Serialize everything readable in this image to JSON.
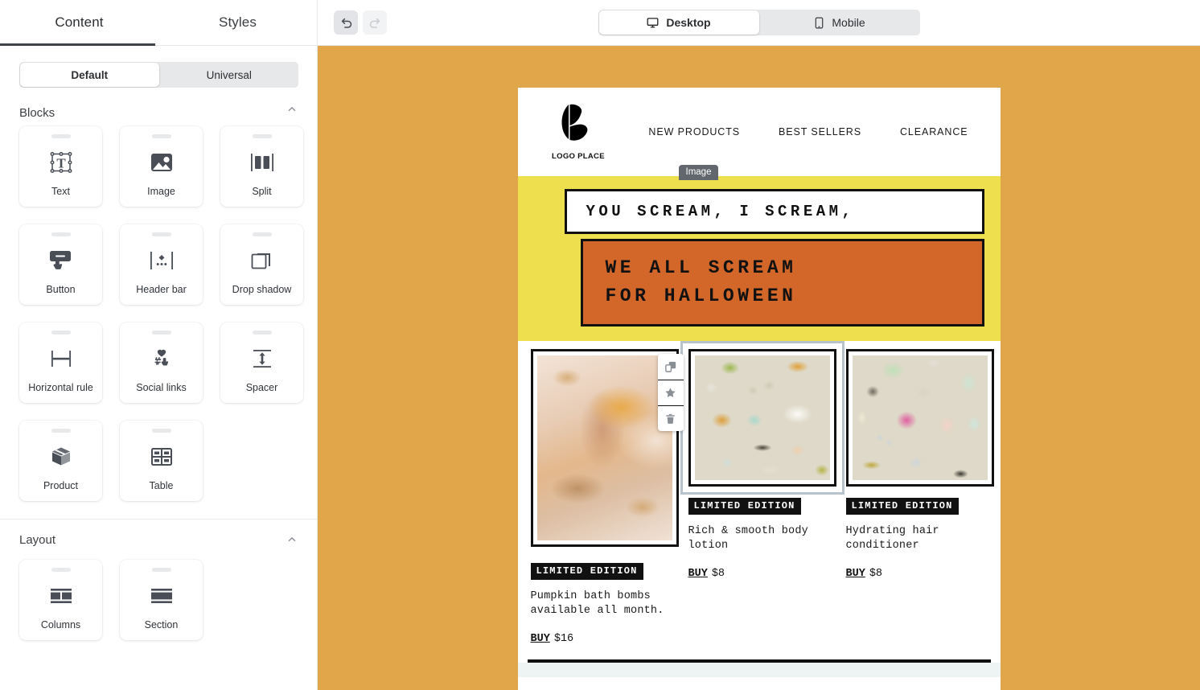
{
  "sidebar": {
    "tabs": [
      {
        "label": "Content",
        "active": true
      },
      {
        "label": "Styles",
        "active": false
      }
    ],
    "segmented": {
      "default_label": "Default",
      "universal_label": "Universal",
      "selected": "Default"
    },
    "sections": [
      {
        "title": "Blocks",
        "items": [
          {
            "label": "Text",
            "icon": "text-icon"
          },
          {
            "label": "Image",
            "icon": "image-icon"
          },
          {
            "label": "Split",
            "icon": "split-icon"
          },
          {
            "label": "Button",
            "icon": "button-icon"
          },
          {
            "label": "Header bar",
            "icon": "header-bar-icon"
          },
          {
            "label": "Drop shadow",
            "icon": "drop-shadow-icon"
          },
          {
            "label": "Horizontal rule",
            "icon": "horizontal-rule-icon"
          },
          {
            "label": "Social links",
            "icon": "social-links-icon"
          },
          {
            "label": "Spacer",
            "icon": "spacer-icon"
          },
          {
            "label": "Product",
            "icon": "product-icon"
          },
          {
            "label": "Table",
            "icon": "table-icon"
          }
        ]
      },
      {
        "title": "Layout",
        "items": [
          {
            "label": "Columns",
            "icon": "columns-icon"
          },
          {
            "label": "Section",
            "icon": "section-icon"
          }
        ]
      }
    ]
  },
  "toolbar": {
    "undo_label": "Undo",
    "redo_label": "Redo",
    "undo_enabled": true,
    "redo_enabled": false,
    "devices": [
      {
        "label": "Desktop",
        "icon": "monitor-icon",
        "active": true
      },
      {
        "label": "Mobile",
        "icon": "phone-icon",
        "active": false
      }
    ]
  },
  "canvas": {
    "background_color": "#e2a64a",
    "selected_block_tooltip": "Image",
    "block_toolbar": [
      {
        "name": "duplicate-icon",
        "label": "Duplicate"
      },
      {
        "name": "star-icon",
        "label": "Favorite"
      },
      {
        "name": "trash-icon",
        "label": "Delete"
      }
    ],
    "email": {
      "header": {
        "logo_text": "LOGO PLACE",
        "nav": [
          "NEW PRODUCTS",
          "BEST SELLERS",
          "CLEARANCE"
        ]
      },
      "banner": {
        "background_color": "#eedf4e",
        "line1": "YOU SCREAM, I SCREAM,",
        "line1_background": "#ffffff",
        "line2a": "WE ALL SCREAM",
        "line2b": "FOR HALLOWEEN",
        "line2_background": "#d3672a"
      },
      "products": [
        {
          "badge": "LIMITED EDITION",
          "description": "Pumpkin bath bombs available all month.",
          "buy_label": "BUY",
          "price": "$16",
          "image_alt": "hands-in-foamy-bath-water"
        },
        {
          "badge": "LIMITED EDITION",
          "description": "Rich & smooth body lotion",
          "buy_label": "BUY",
          "price": "$8",
          "image_alt": "cosmetic-swatches-beige"
        },
        {
          "badge": "LIMITED EDITION",
          "description": "Hydrating hair conditioner",
          "buy_label": "BUY",
          "price": "$8",
          "image_alt": "cosmetic-swatches-pink"
        }
      ]
    }
  }
}
